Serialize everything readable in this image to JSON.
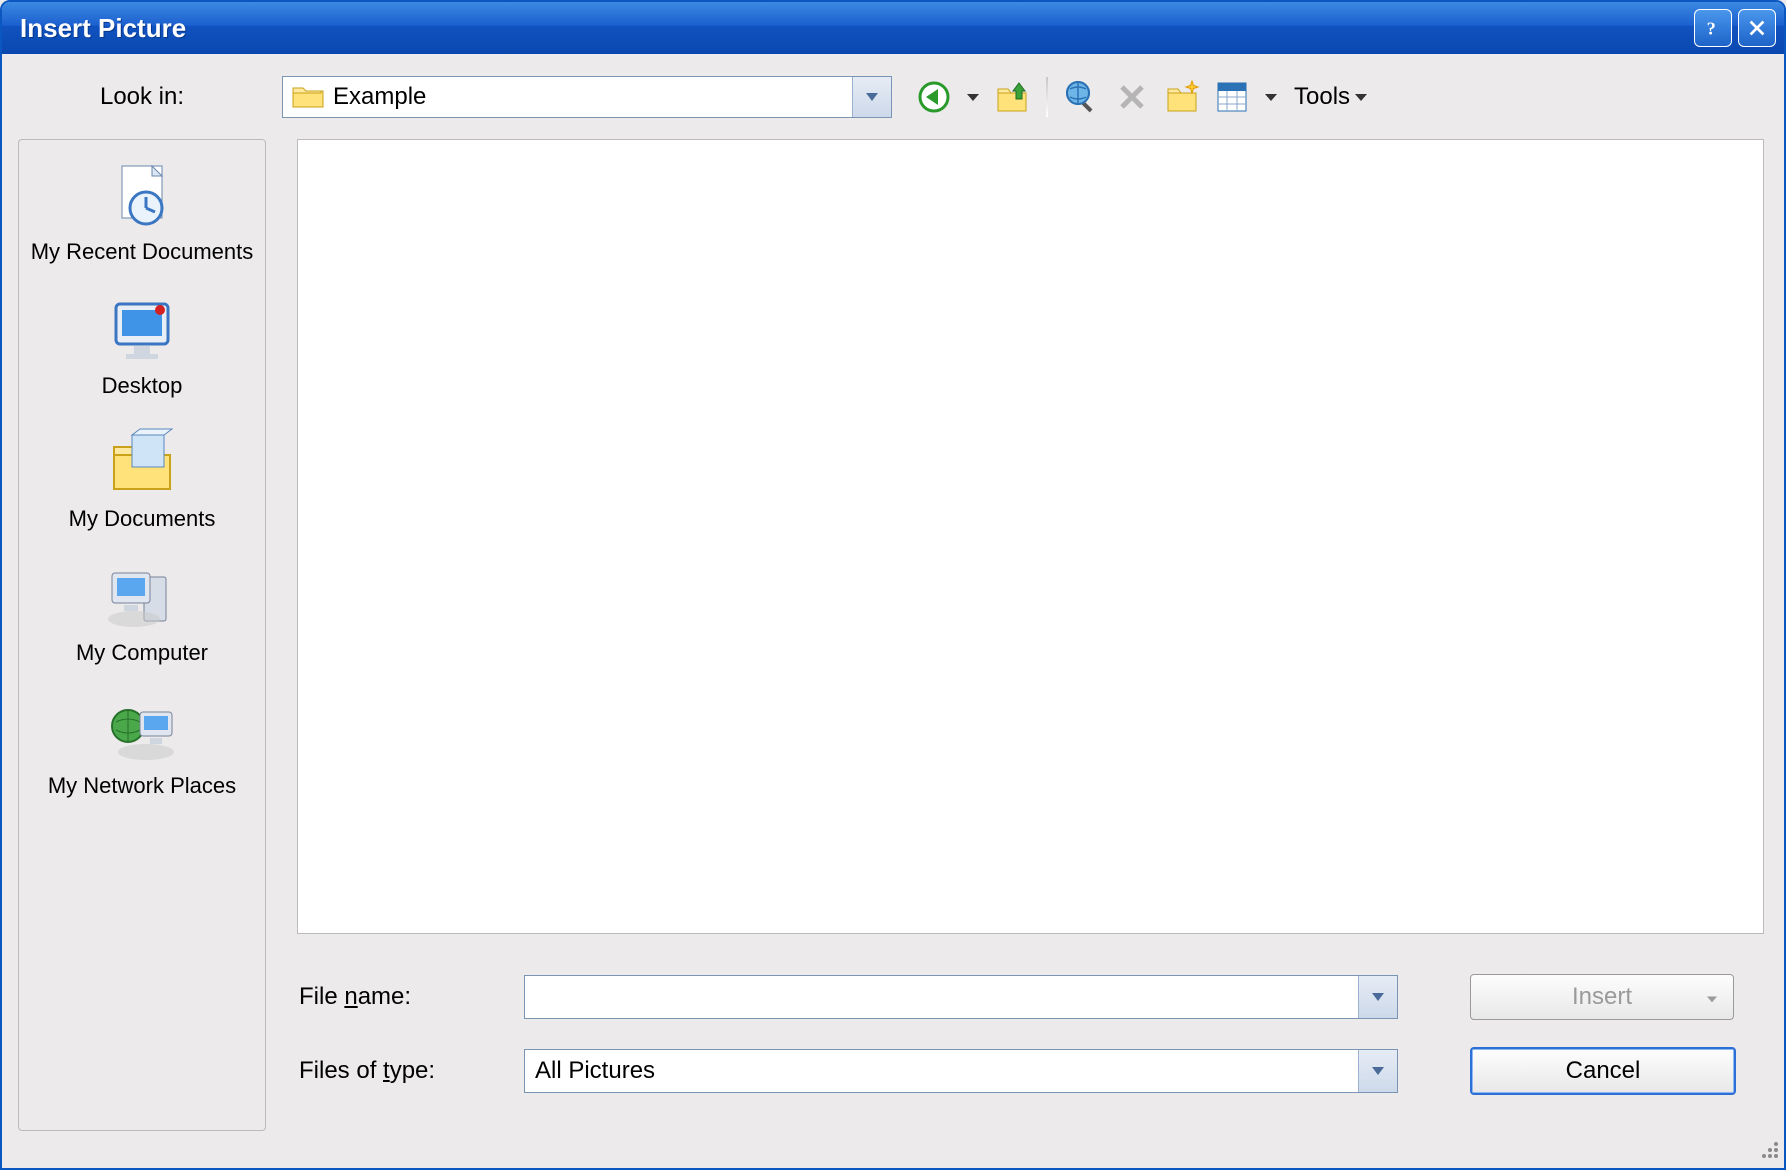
{
  "window": {
    "title": "Insert Picture"
  },
  "toprow": {
    "lookin_label": "Look in:",
    "lookin_value": "Example",
    "tools_label": "Tools"
  },
  "places": {
    "items": [
      {
        "label": "My Recent Documents"
      },
      {
        "label": "Desktop"
      },
      {
        "label": "My Documents"
      },
      {
        "label": "My Computer"
      },
      {
        "label": "My Network Places"
      }
    ]
  },
  "bottom": {
    "filename_label_pre": "File ",
    "filename_label_ul": "n",
    "filename_label_post": "ame:",
    "filename_value": "",
    "filetype_label_pre": "Files of ",
    "filetype_label_ul": "t",
    "filetype_label_post": "ype:",
    "filetype_value": "All Pictures",
    "insert_label": "Insert",
    "cancel_label": "Cancel"
  }
}
